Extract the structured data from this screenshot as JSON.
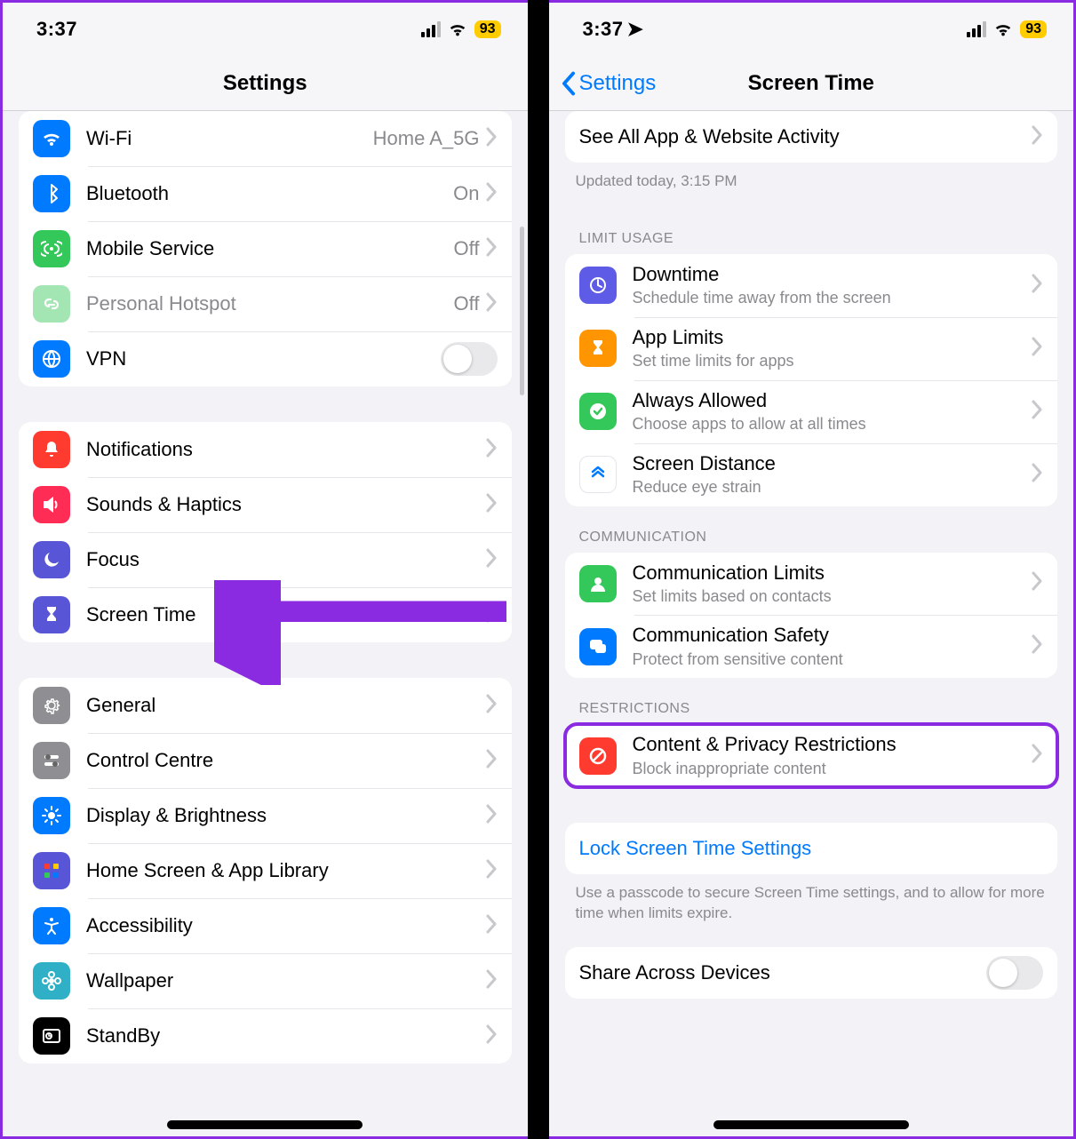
{
  "status": {
    "time": "3:37",
    "battery": "93"
  },
  "left": {
    "title": "Settings",
    "network": [
      {
        "icon": "wifi",
        "color": "#007aff",
        "title": "Wi-Fi",
        "value": "Home A_5G",
        "chev": true
      },
      {
        "icon": "bt",
        "color": "#007aff",
        "title": "Bluetooth",
        "value": "On",
        "chev": true
      },
      {
        "icon": "cell",
        "color": "#34c759",
        "title": "Mobile Service",
        "value": "Off",
        "chev": true
      },
      {
        "icon": "link",
        "color": "#34c759",
        "title": "Personal Hotspot",
        "value": "Off",
        "chev": true,
        "dim": true
      },
      {
        "icon": "globe",
        "color": "#007aff",
        "title": "VPN",
        "toggle": true
      }
    ],
    "notif": [
      {
        "icon": "bell",
        "color": "#ff3b30",
        "title": "Notifications",
        "chev": true
      },
      {
        "icon": "speaker",
        "color": "#ff2d55",
        "title": "Sounds & Haptics",
        "chev": true
      },
      {
        "icon": "moon",
        "color": "#5856d6",
        "title": "Focus",
        "chev": true
      },
      {
        "icon": "hourglass",
        "color": "#5856d6",
        "title": "Screen Time",
        "chev": true
      }
    ],
    "general": [
      {
        "icon": "gear",
        "color": "#8e8e93",
        "title": "General",
        "chev": true
      },
      {
        "icon": "switches",
        "color": "#8e8e93",
        "title": "Control Centre",
        "chev": true
      },
      {
        "icon": "sun",
        "color": "#007aff",
        "title": "Display & Brightness",
        "chev": true
      },
      {
        "icon": "grid",
        "color": "#5856d6",
        "title": "Home Screen & App Library",
        "chev": true
      },
      {
        "icon": "access",
        "color": "#007aff",
        "title": "Accessibility",
        "chev": true
      },
      {
        "icon": "flower",
        "color": "#30b0c7",
        "title": "Wallpaper",
        "chev": true
      },
      {
        "icon": "clock",
        "color": "#000000",
        "title": "StandBy",
        "chev": true
      }
    ]
  },
  "right": {
    "back": "Settings",
    "title": "Screen Time",
    "activity_row": "See All App & Website Activity",
    "updated": "Updated today, 3:15 PM",
    "limit_header": "LIMIT USAGE",
    "limit": [
      {
        "icon": "downtime",
        "color": "#5e5ce6",
        "title": "Downtime",
        "sub": "Schedule time away from the screen"
      },
      {
        "icon": "timer",
        "color": "#ff9500",
        "title": "App Limits",
        "sub": "Set time limits for apps"
      },
      {
        "icon": "check",
        "color": "#34c759",
        "title": "Always Allowed",
        "sub": "Choose apps to allow at all times"
      },
      {
        "icon": "distance",
        "color": "#ffffff",
        "title": "Screen Distance",
        "sub": "Reduce eye strain",
        "white": true
      }
    ],
    "comm_header": "COMMUNICATION",
    "comm": [
      {
        "icon": "person",
        "color": "#34c759",
        "title": "Communication Limits",
        "sub": "Set limits based on contacts"
      },
      {
        "icon": "bubble",
        "color": "#007aff",
        "title": "Communication Safety",
        "sub": "Protect from sensitive content"
      }
    ],
    "restr_header": "RESTRICTIONS",
    "restr": [
      {
        "icon": "nosign",
        "color": "#ff3b30",
        "title": "Content & Privacy Restrictions",
        "sub": "Block inappropriate content"
      }
    ],
    "lock_row": "Lock Screen Time Settings",
    "lock_foot": "Use a passcode to secure Screen Time settings, and to allow for more time when limits expire.",
    "share_row": "Share Across Devices"
  }
}
